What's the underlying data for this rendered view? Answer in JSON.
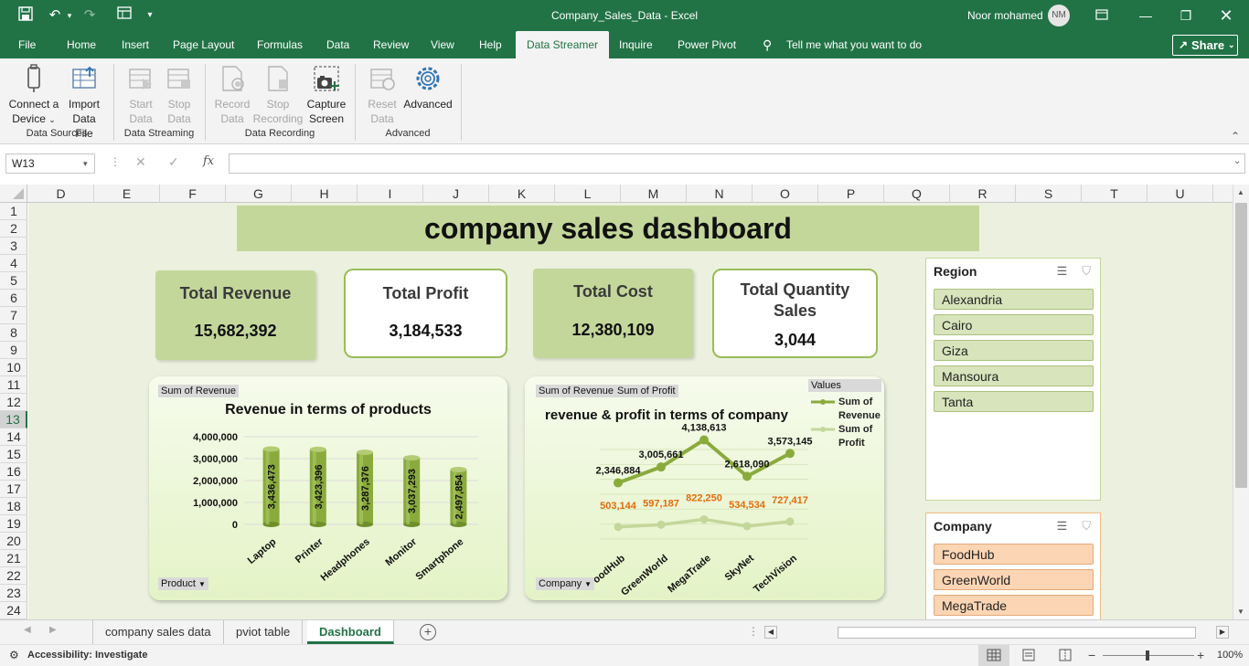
{
  "app": {
    "doc_title": "Company_Sales_Data  -  Excel",
    "user_name": "Noor mohamed",
    "user_initials": "NM"
  },
  "menu": {
    "tabs": [
      "File",
      "Home",
      "Insert",
      "Page Layout",
      "Formulas",
      "Data",
      "Review",
      "View",
      "Help",
      "Data Streamer",
      "Inquire",
      "Power Pivot"
    ],
    "tell_me": "Tell me what you want to do",
    "share": "Share"
  },
  "ribbon": {
    "connect_a": "Connect a",
    "device": "Device",
    "import": "Import",
    "data_file": "Data File",
    "group_sources": "Data Sources",
    "start": "Start",
    "start2": "Data",
    "stop": "Stop",
    "stop2": "Data",
    "group_streaming": "Data Streaming",
    "record": "Record",
    "record2": "Data",
    "stop_rec": "Stop",
    "stop_rec2": "Recording",
    "capture": "Capture",
    "capture2": "Screen",
    "group_recording": "Data Recording",
    "reset": "Reset",
    "reset2": "Data",
    "advanced": "Advanced",
    "group_advanced": "Advanced"
  },
  "formula_bar": {
    "name_box": "W13",
    "fx": "fx",
    "formula": ""
  },
  "columns": [
    "D",
    "E",
    "F",
    "G",
    "H",
    "I",
    "J",
    "K",
    "L",
    "M",
    "N",
    "O",
    "P",
    "Q",
    "R",
    "S",
    "T",
    "U"
  ],
  "rows": [
    "1",
    "2",
    "3",
    "4",
    "5",
    "6",
    "7",
    "8",
    "9",
    "10",
    "11",
    "12",
    "13",
    "14",
    "15",
    "16",
    "17",
    "18",
    "19",
    "20",
    "21",
    "22",
    "23",
    "24"
  ],
  "dashboard": {
    "title": "company sales dashboard",
    "kpis": {
      "revenue_label": "Total Revenue",
      "revenue_value": "15,682,392",
      "profit_label": "Total Profit",
      "profit_value": "3,184,533",
      "cost_label": "Total Cost",
      "cost_value": "12,380,109",
      "qty_label_1": "Total Quantity",
      "qty_label_2": "Sales",
      "qty_value": "3,044"
    },
    "chart1_field": "Sum of Revenue",
    "chart1_axis_button": "Product",
    "chart2_field_revenue": "Sum of Revenue",
    "chart2_field_profit": "Sum of Profit",
    "chart2_axis_button": "Company",
    "chart2_legend_title": "Values",
    "chart2_legend_rev_1": "Sum of",
    "chart2_legend_rev_2": "Revenue",
    "chart2_legend_prof_1": "Sum of",
    "chart2_legend_prof_2": "Profit"
  },
  "chart_data": [
    {
      "type": "bar",
      "title": "Revenue in terms of products",
      "categories": [
        "Laptop",
        "Printer",
        "Headphones",
        "Monitor",
        "Smartphone"
      ],
      "values": [
        3436473,
        3423396,
        3287376,
        3037293,
        2497854
      ],
      "value_labels": [
        "3,436,473",
        "3,423,396",
        "3,287,376",
        "3,037,293",
        "2,497,854"
      ],
      "yticks": [
        "4,000,000",
        "3,000,000",
        "2,000,000",
        "1,000,000",
        "0"
      ],
      "ylim": [
        0,
        4000000
      ],
      "color": "#8aab3c"
    },
    {
      "type": "line",
      "title": "revenue & profit in terms of company",
      "categories": [
        "FoodHub",
        "GreenWorld",
        "MegaTrade",
        "SkyNet",
        "TechVision"
      ],
      "series": [
        {
          "name": "Sum of Revenue",
          "values": [
            2346884,
            3005661,
            4138613,
            2618090,
            3573145
          ],
          "labels": [
            "2,346,884",
            "3,005,661",
            "4,138,613",
            "2,618,090",
            "3,573,145"
          ],
          "color": "#8aab3c"
        },
        {
          "name": "Sum of Profit",
          "values": [
            503144,
            597187,
            822250,
            534534,
            727417
          ],
          "labels": [
            "503,144",
            "597,187",
            "822,250",
            "534,534",
            "727,417"
          ],
          "color": "#c4d79b"
        }
      ],
      "ylim": [
        0,
        4500000
      ]
    }
  ],
  "slicers": {
    "region_title": "Region",
    "region_items": [
      "Alexandria",
      "Cairo",
      "Giza",
      "Mansoura",
      "Tanta"
    ],
    "company_title": "Company",
    "company_items": [
      "FoodHub",
      "GreenWorld",
      "MegaTrade"
    ]
  },
  "sheets": [
    "company sales data",
    "pviot table",
    "Dashboard"
  ],
  "status": {
    "accessibility": "Accessibility: Investigate",
    "zoom": "100%"
  },
  "colors": {
    "excel_green": "#217346",
    "kpi_green": "#c4d79b",
    "sheet_bg": "#ebf1de",
    "slicer_orange": "#fcd5b4",
    "profit_label": "#e36c09"
  }
}
